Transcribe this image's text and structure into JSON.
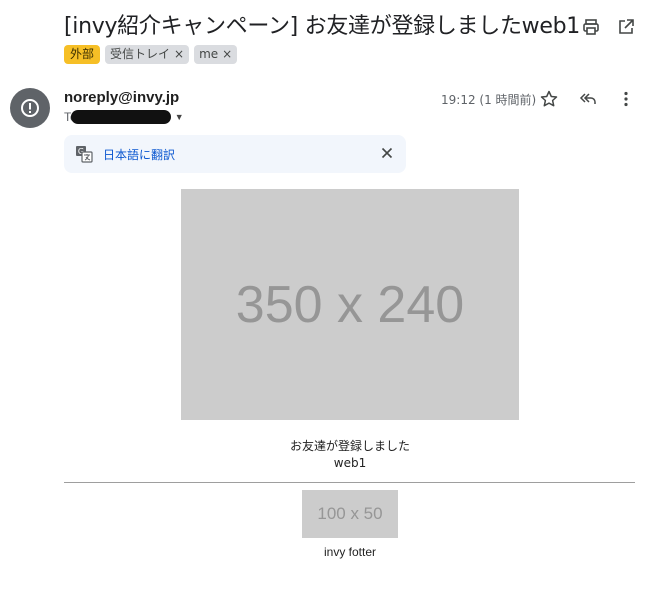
{
  "email": {
    "subject": "[invy紹介キャンペーン] お友達が登録しましたweb1",
    "labels": {
      "external": "外部",
      "inbox": "受信トレイ",
      "me": "me",
      "remove_glyph": "×"
    },
    "sender": "noreply@invy.jp",
    "to_prefix": "To",
    "time": "19:12 (1 時間前)",
    "translate": {
      "link_label": "日本語に翻訳"
    },
    "body": {
      "hero_placeholder": "350 x 240",
      "message_line1": "お友達が登録しました",
      "message_line2": "web1",
      "footer_placeholder": "100 x 50",
      "footer_text": "invy fotter"
    }
  },
  "icons": {
    "print": "printer-icon",
    "open_new_window": "open-in-new-icon",
    "avatar": "exclamation-circle-icon",
    "star": "star-outline-icon",
    "reply_all": "reply-all-icon",
    "more": "more-vert-icon",
    "translate": "translate-icon",
    "close": "close-icon",
    "caret": "caret-down-icon"
  },
  "colors": {
    "external_chip": "#f6bf26",
    "gray_chip": "#dadce0",
    "link_blue": "#0b57d0",
    "translate_bg": "#f2f6fc",
    "avatar_bg": "#5f6368",
    "placeholder_bg": "#cccccc",
    "placeholder_text": "#969696"
  }
}
